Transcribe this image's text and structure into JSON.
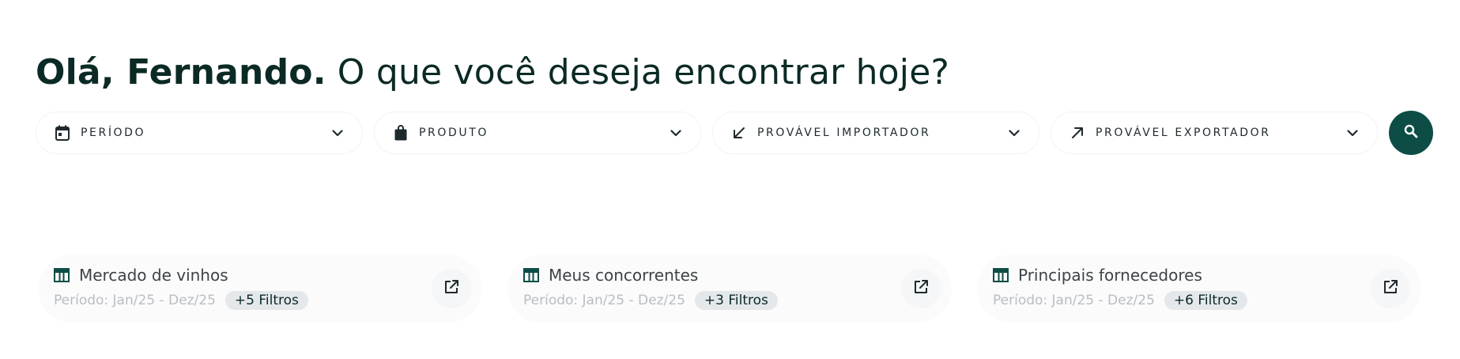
{
  "header": {
    "greeting_name": "Olá, Fernando.",
    "greeting_rest": " O que você deseja encontrar hoje?"
  },
  "filters": [
    {
      "label": "PERÍODO",
      "icon": "calendar-icon"
    },
    {
      "label": "PRODUTO",
      "icon": "shopping-bag-icon"
    },
    {
      "label": "PROVÁVEL IMPORTADOR",
      "icon": "arrow-down-left-icon"
    },
    {
      "label": "PROVÁVEL EXPORTADOR",
      "icon": "arrow-up-right-icon"
    }
  ],
  "search": {
    "icon": "search-icon"
  },
  "saved_searches": [
    {
      "title": "Mercado de vinhos",
      "period": "Período: Jan/25 - Dez/25",
      "filters_badge": "+5 Filtros"
    },
    {
      "title": "Meus concorrentes",
      "period": "Período: Jan/25 - Dez/25",
      "filters_badge": "+3 Filtros"
    },
    {
      "title": "Principais fornecedores",
      "period": "Período: Jan/25 - Dez/25",
      "filters_badge": "+6 Filtros"
    }
  ],
  "colors": {
    "brand": "#0d4d45",
    "heading": "#0b2a26",
    "muted": "#b9bec2",
    "badge_bg": "#e5e8eb"
  }
}
